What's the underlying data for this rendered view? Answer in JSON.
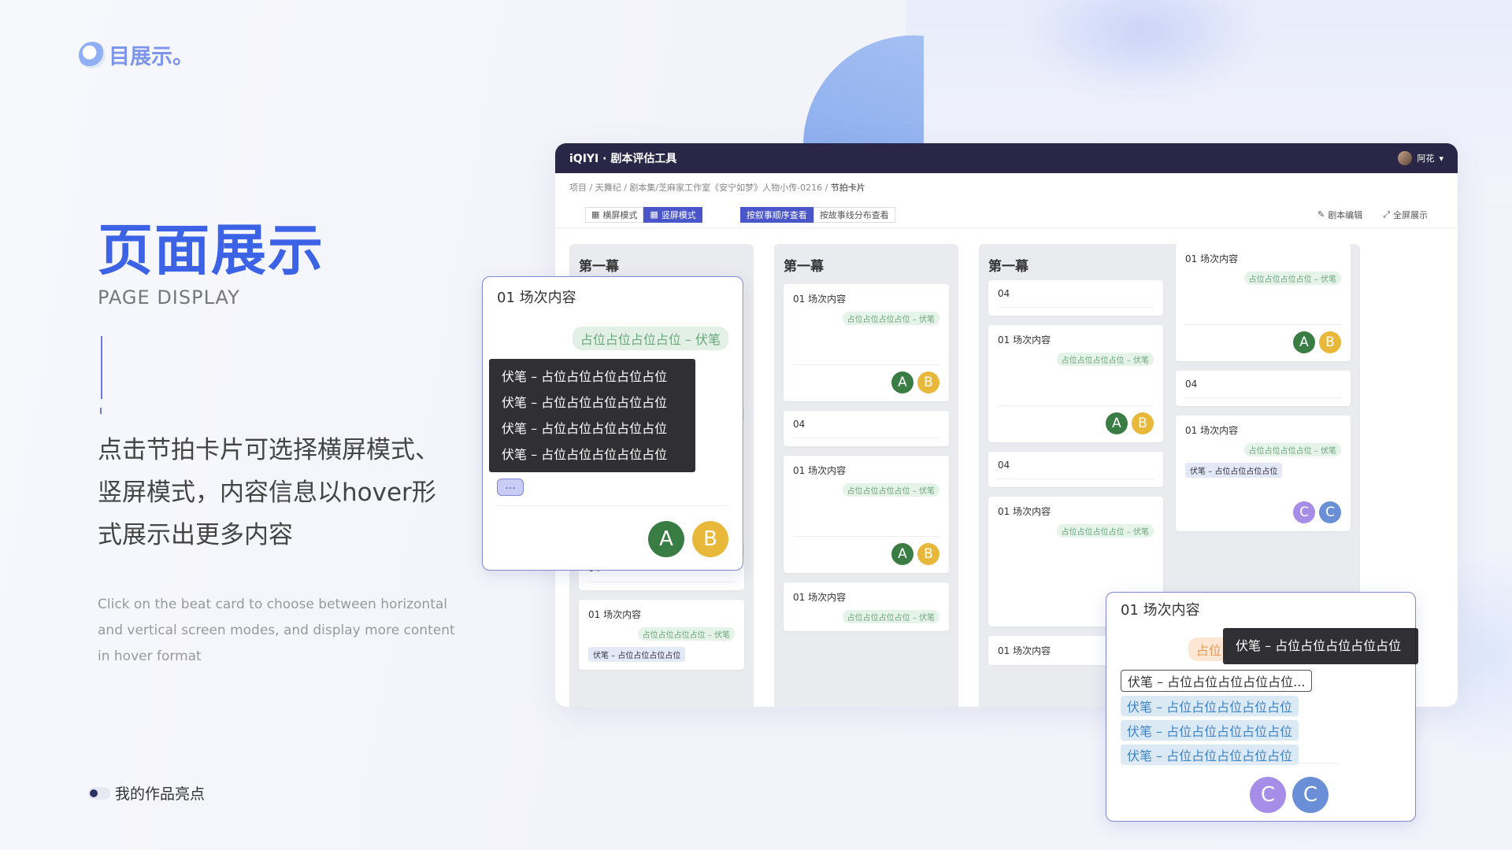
{
  "logo_text": "目展示。",
  "title": "页面展示",
  "subtitle": "PAGE DISPLAY",
  "desc_cn": "点击节拍卡片可选择横屏模式、竖屏模式，内容信息以hover形式展示出更多内容",
  "desc_en": "Click on the beat card to choose between horizontal and vertical screen modes, and display more content in hover format",
  "toggle_label": "我的作品亮点",
  "app": {
    "brand": "iQIYI · 剧本评估工具",
    "user_name": "阿花",
    "breadcrumb_prefix": "项目 / 天舞纪 / 剧本集/芝麻家工作室《安宁如梦》人物小传-0216 /",
    "breadcrumb_current": "节拍卡片",
    "toolbar": {
      "landscape": "横屏模式",
      "portrait": "竖屏模式",
      "by_order": "按叙事顺序查看",
      "by_line": "按故事线分布查看",
      "edit": "剧本编辑",
      "fullscreen": "全屏展示"
    },
    "act_title": "第一幕",
    "scene": "01 场次内容",
    "tag": "占位占位占位占位 – 伏笔",
    "num": "04",
    "foot": "伏笔 – 占位占位占位占位",
    "av": {
      "a": "A",
      "b": "B",
      "c": "C"
    }
  },
  "pop1": {
    "title": "01 场次内容",
    "tag": "占位占位占位占位 – 伏笔",
    "tips": [
      "伏笔  –  占位占位占位占位占位",
      "伏笔  –  占位占位占位占位占位",
      "伏笔  –  占位占位占位占位占位",
      "伏笔  –  占位占位占位占位占位"
    ],
    "more": "..."
  },
  "pop2": {
    "title": "01 场次内容",
    "tag_partial": "占位",
    "tip": "伏笔  –  占位占位占位占位占位",
    "selected": "伏笔 – 占位占位占位占位占位...",
    "items": [
      "伏笔 – 占位占位占位占位占位",
      "伏笔 – 占位占位占位占位占位",
      "伏笔 – 占位占位占位占位占位"
    ]
  }
}
